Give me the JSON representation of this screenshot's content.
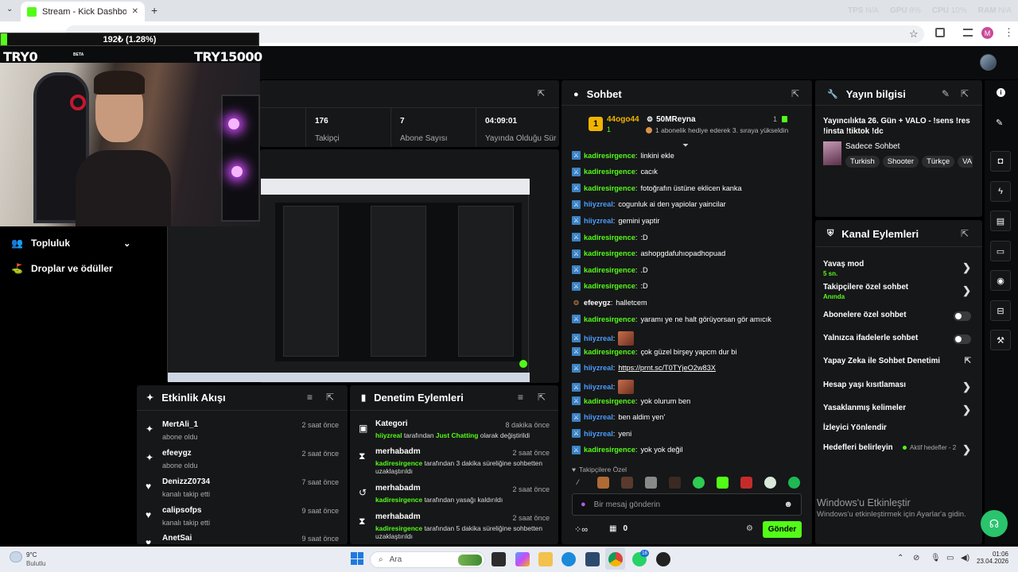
{
  "browser": {
    "tab_title": "Stream - Kick Dashboard",
    "new_tab": "+",
    "close": "✕",
    "perf": {
      "tps_label": "TPS",
      "tps_value": "N/A",
      "gpu_label": "GPU",
      "gpu_value": "8%",
      "cpu_label": "CPU",
      "cpu_value": "10%",
      "ram_label": "RAM",
      "ram_value": "N/A"
    },
    "profile_initial": "M"
  },
  "overlay": {
    "goal_current": "192₺ (1.28%)",
    "goal_progress_pct": 1.28,
    "goal_left": "TRY0",
    "goal_right": "TRY15000",
    "beta": "BETA"
  },
  "left_nav": {
    "items": [
      {
        "label": "Topluluk"
      },
      {
        "label": "Droplar ve ödüller"
      }
    ]
  },
  "stats": [
    {
      "value": "176",
      "label": "Takipçi"
    },
    {
      "value": "7",
      "label": "Abone Sayısı"
    },
    {
      "value": "04:09:01",
      "label": "Yayında Olduğu Süre"
    }
  ],
  "activity": {
    "title": "Etkinlik Akışı",
    "items": [
      {
        "icon": "sparkle-icon",
        "name": "MertAli_1",
        "sub": "abone oldu",
        "time": "2 saat önce"
      },
      {
        "icon": "sparkle-icon",
        "name": "efeeygz",
        "sub": "abone oldu",
        "time": "2 saat önce"
      },
      {
        "icon": "heart-icon",
        "name": "DenizzZ0734",
        "sub": "kanalı takip etti",
        "time": "7 saat önce"
      },
      {
        "icon": "heart-icon",
        "name": "calipsofps",
        "sub": "kanalı takip etti",
        "time": "9 saat önce"
      },
      {
        "icon": "heart-icon",
        "name": "AnetSai",
        "sub": "",
        "time": "9 saat önce"
      }
    ]
  },
  "moderation": {
    "title": "Denetim Eylemleri",
    "items": [
      {
        "name": "Kategori",
        "time": "8 dakika önce",
        "actor": "hiiyzreal",
        "mid": " tarafından ",
        "target": "Just Chatting",
        "rest": " olarak değiştirildi"
      },
      {
        "name": "merhabadm",
        "time": "2 saat önce",
        "actor": "kadiresirgence",
        "mid": " tarafından 3 dakika süreliğine sohbetten uzaklaştırıldı",
        "target": "",
        "rest": ""
      },
      {
        "name": "merhabadm",
        "time": "2 saat önce",
        "actor": "kadiresirgence",
        "mid": " tarafından yasağı kaldırıldı",
        "target": "",
        "rest": ""
      },
      {
        "name": "merhabadm",
        "time": "2 saat önce",
        "actor": "kadiresirgence",
        "mid": " tarafından 5 dakika süreliğine sohbetten uzaklaştırıldı",
        "target": "",
        "rest": ""
      }
    ]
  },
  "chat": {
    "title": "Sohbet",
    "leader": {
      "rank": "1",
      "name": "44ogo44",
      "count": "1",
      "gifter": "50MReyna",
      "gifter_count": "1",
      "gift_text": "1 abonelik hediye ederek 3. sıraya yükseldin"
    },
    "messages": [
      {
        "user": "kadiresirgence",
        "color": "#53fc18",
        "text": "linkini ekle"
      },
      {
        "user": "kadiresirgence",
        "color": "#53fc18",
        "text": "cacık"
      },
      {
        "user": "kadiresirgence",
        "color": "#53fc18",
        "text": "fotoğrafın üstüne eklicen kanka"
      },
      {
        "user": "hiiyzreal",
        "color": "#4a9dff",
        "text": "cogunluk ai den yapiolar yaincilar"
      },
      {
        "user": "hiiyzreal",
        "color": "#4a9dff",
        "text": "gemini yaptir"
      },
      {
        "user": "kadiresirgence",
        "color": "#53fc18",
        "text": ":D"
      },
      {
        "user": "kadiresirgence",
        "color": "#53fc18",
        "text": "ashopgdafuhıopadhopuad"
      },
      {
        "user": "kadiresirgence",
        "color": "#53fc18",
        "text": ".D"
      },
      {
        "user": "kadiresirgence",
        "color": "#53fc18",
        "text": ":D"
      },
      {
        "user": "efeeygz",
        "color": "#ffffff",
        "text": "halletcem"
      },
      {
        "user": "kadiresirgence",
        "color": "#53fc18",
        "text": "yaramı ye ne halt görüyorsan gör amıcık"
      },
      {
        "user": "hiiyzreal",
        "color": "#4a9dff",
        "text": ""
      },
      {
        "user": "kadiresirgence",
        "color": "#53fc18",
        "text": "çok güzel birşey yapcm dur bi"
      },
      {
        "user": "hiiyzreal",
        "color": "#4a9dff",
        "text": "https://prnt.sc/T0TYjeO2w83X"
      },
      {
        "user": "hiiyzreal",
        "color": "#4a9dff",
        "text": ""
      },
      {
        "user": "kadiresirgence",
        "color": "#53fc18",
        "text": "yok olurum ben"
      },
      {
        "user": "hiiyzreal",
        "color": "#4a9dff",
        "text": "ben aldim yen'"
      },
      {
        "user": "hiiyzreal",
        "color": "#4a9dff",
        "text": "yeni"
      },
      {
        "user": "kadiresirgence",
        "color": "#53fc18",
        "text": "yok yok değil"
      }
    ],
    "followers_only": "Takipçilere Özel",
    "placeholder": "Bir mesaj gönderin",
    "points": "0",
    "send": "Gönder"
  },
  "stream_info": {
    "title_label": "Yayın bilgisi",
    "stream_title": "Yayıncılıkta 26. Gün + VALO - !sens !res !insta !tiktok !dc",
    "category": "Sadece Sohbet",
    "tags": [
      "Turkish",
      "Shooter",
      "Türkçe",
      "VA"
    ]
  },
  "channel_actions": {
    "title": "Kanal Eylemleri",
    "items": [
      {
        "label": "Yavaş mod",
        "sub": "5 sn.",
        "control": "chevron"
      },
      {
        "label": "Takipçilere özel sohbet",
        "sub": "Anında",
        "control": "chevron"
      },
      {
        "label": "Abonelere özel sohbet",
        "sub": "",
        "control": "toggle"
      },
      {
        "label": "Yalnızca ifadelerle sohbet",
        "sub": "",
        "control": "toggle"
      },
      {
        "label": "Yapay Zeka ile Sohbet Denetimi",
        "sub": "",
        "control": "external"
      },
      {
        "label": "Hesap yaşı kısıtlaması",
        "sub": "",
        "control": "chevron"
      },
      {
        "label": "Yasaklanmış kelimeler",
        "sub": "",
        "control": "chevron"
      },
      {
        "label": "İzleyici Yönlendir",
        "sub": "",
        "control": "none"
      },
      {
        "label": "Hedefleri belirleyin",
        "sub": "",
        "control": "chevron",
        "status": "Aktif hedefler - 2"
      }
    ]
  },
  "windows": {
    "watermark_title": "Windows'u Etkinleştir",
    "watermark_sub": "Windows'u etkinleştirmek için Ayarlar'a gidin.",
    "weather_temp": "9°C",
    "weather_desc": "Bulutlu",
    "search": "Ara",
    "time": "01:06",
    "date": "23.04.2026",
    "badge": "16"
  },
  "colors": {
    "accent": "#53fc18",
    "panel": "#161718",
    "hiiyzreal": "#4a9dff"
  }
}
